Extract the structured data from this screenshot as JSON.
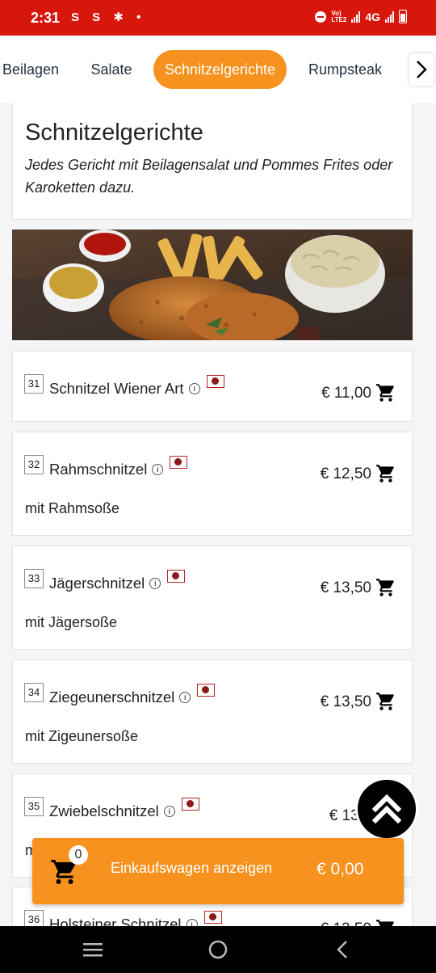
{
  "status": {
    "time": "2:31",
    "left_icons": "S S ✱ •",
    "network": "4G"
  },
  "categories": [
    {
      "label": "Beilagen",
      "active": false
    },
    {
      "label": "Salate",
      "active": false
    },
    {
      "label": "Schnitzelgerichte",
      "active": true
    },
    {
      "label": "Rumpsteak",
      "active": false
    }
  ],
  "section": {
    "title": "Schnitzelgerichte",
    "subtitle": "Jedes Gericht mit Beilagensalat und Pommes Frites oder Karoketten dazu."
  },
  "items": [
    {
      "number": "31",
      "name": "Schnitzel Wiener Art",
      "price": "€ 11,00",
      "description": ""
    },
    {
      "number": "32",
      "name": "Rahmschnitzel",
      "price": "€ 12,50",
      "description": "mit Rahmsoße"
    },
    {
      "number": "33",
      "name": "Jägerschnitzel",
      "price": "€ 13,50",
      "description": "mit Jägersoße"
    },
    {
      "number": "34",
      "name": "Ziegeunerschnitzel",
      "price": "€ 13,50",
      "description": "mit Zigeunersoße"
    },
    {
      "number": "35",
      "name": "Zwiebelschnitzel",
      "price": "€ 13,",
      "description": "m"
    },
    {
      "number": "36",
      "name": "Holsteiner Schnitzel",
      "price": "€ 13,50",
      "description": ""
    }
  ],
  "cart": {
    "count": "0",
    "label": "Einkaufswagen anzeigen",
    "total": "€ 0,00"
  },
  "colors": {
    "status_bar": "#d7160c",
    "accent": "#f7921e"
  }
}
